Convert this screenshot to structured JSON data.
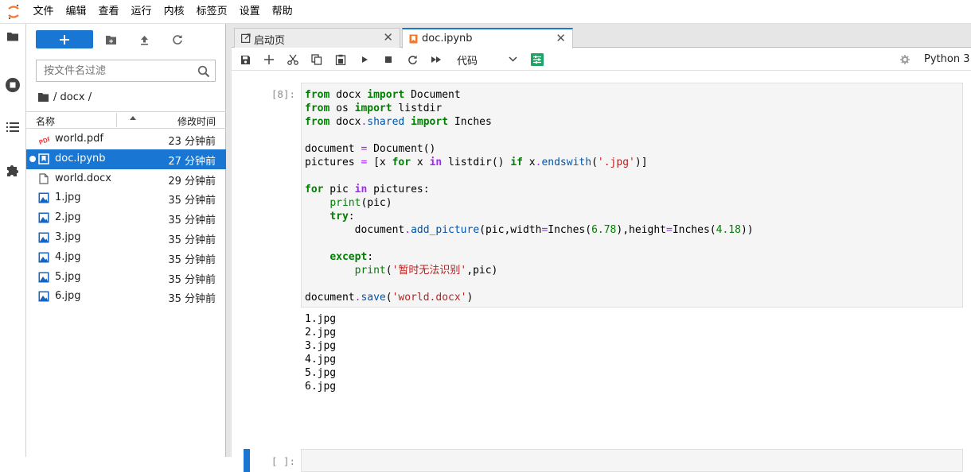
{
  "menubar": {
    "items": [
      "文件",
      "编辑",
      "查看",
      "运行",
      "内核",
      "标签页",
      "设置",
      "帮助"
    ]
  },
  "colors": {
    "accent": "#1976d2",
    "jupyter_orange": "#f37726"
  },
  "filebrowser": {
    "search_placeholder": "按文件名过滤",
    "breadcrumb": "/ docx /",
    "header": {
      "name": "名称",
      "modified": "修改时间"
    },
    "files": [
      {
        "name": "world.pdf",
        "time": "23 分钟前",
        "icon": "pdf-icon",
        "selected": false
      },
      {
        "name": "doc.ipynb",
        "time": "27 分钟前",
        "icon": "notebook-icon",
        "selected": true
      },
      {
        "name": "world.docx",
        "time": "29 分钟前",
        "icon": "file-icon",
        "selected": false
      },
      {
        "name": "1.jpg",
        "time": "35 分钟前",
        "icon": "image-icon",
        "selected": false
      },
      {
        "name": "2.jpg",
        "time": "35 分钟前",
        "icon": "image-icon",
        "selected": false
      },
      {
        "name": "3.jpg",
        "time": "35 分钟前",
        "icon": "image-icon",
        "selected": false
      },
      {
        "name": "4.jpg",
        "time": "35 分钟前",
        "icon": "image-icon",
        "selected": false
      },
      {
        "name": "5.jpg",
        "time": "35 分钟前",
        "icon": "image-icon",
        "selected": false
      },
      {
        "name": "6.jpg",
        "time": "35 分钟前",
        "icon": "image-icon",
        "selected": false
      }
    ]
  },
  "tabs": [
    {
      "label": "启动页",
      "active": false
    },
    {
      "label": "doc.ipynb",
      "active": true
    }
  ],
  "toolbar": {
    "cell_type": "代码",
    "kernel": "Python 3"
  },
  "cells": [
    {
      "prompt": "[8]:",
      "code": [
        "from docx import Document",
        "from os import listdir",
        "from docx.shared import Inches",
        "",
        "document = Document()",
        "pictures = [x for x in listdir() if x.endswith('.jpg')]",
        "",
        "for pic in pictures:",
        "    print(pic)",
        "    try:",
        "        document.add_picture(pic,width=Inches(6.78),height=Inches(4.18))",
        "",
        "    except:",
        "        print('暂时无法识别',pic)",
        "",
        "document.save('world.docx')"
      ],
      "output": [
        "1.jpg",
        "2.jpg",
        "3.jpg",
        "4.jpg",
        "5.jpg",
        "6.jpg"
      ]
    },
    {
      "prompt": "[ ]:",
      "code": [],
      "output": []
    }
  ]
}
